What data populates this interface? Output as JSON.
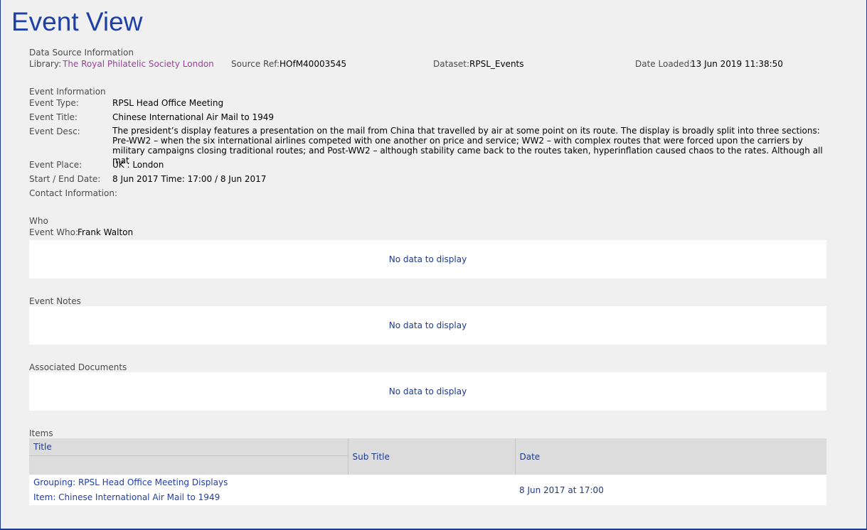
{
  "page": {
    "title": "Event View"
  },
  "data_source": {
    "heading": "Data Source Information",
    "library_label": "Library:",
    "library_value": "The Royal Philatelic Society London",
    "source_ref_label": "Source Ref:",
    "source_ref_value": "HOfM40003545",
    "dataset_label": "Dataset:",
    "dataset_value": "RPSL_Events",
    "date_loaded_label": "Date Loaded:",
    "date_loaded_value": "13 Jun 2019 11:38:50"
  },
  "event_info": {
    "heading": "Event Information",
    "type_label": "Event Type:",
    "type_value": "RPSL Head Office Meeting",
    "title_label": "Event Title:",
    "title_value": "Chinese International Air Mail to 1949",
    "desc_label": "Event Desc:",
    "desc_value": "The president’s display features a presentation on the mail from China that travelled by air at some point on its route. The display is broadly split into three sections: Pre-WW2 – when the six international airlines competed with one another on price and service; WW2 – with complex routes that were forced upon the carriers by military campaigns closing traditional routes; and Post-WW2 – although stability came back to the routes taken, hyperinflation caused chaos to the rates. Although all mat",
    "place_label": "Event Place:",
    "place_value": "UK : London",
    "dates_label": "Start / End Date:",
    "dates_value": "8 Jun 2017 Time: 17:00 / 8 Jun 2017",
    "contact_label": "Contact Information:"
  },
  "who": {
    "heading": "Who",
    "event_who_label": "Event Who:",
    "event_who_value": "Frank Walton",
    "empty_text": "No data to display"
  },
  "event_notes": {
    "heading": "Event Notes",
    "empty_text": "No data to display"
  },
  "associated_documents": {
    "heading": "Associated Documents",
    "empty_text": "No data to display"
  },
  "items": {
    "heading": "Items",
    "columns": [
      "Title",
      "Sub Title",
      "Date"
    ],
    "rows": [
      {
        "grouping": "Grouping: RPSL Head Office Meeting Displays",
        "item": "Item: Chinese International Air Mail to 1949",
        "sub_title": "",
        "date": "8 Jun 2017 at 17:00"
      }
    ]
  }
}
